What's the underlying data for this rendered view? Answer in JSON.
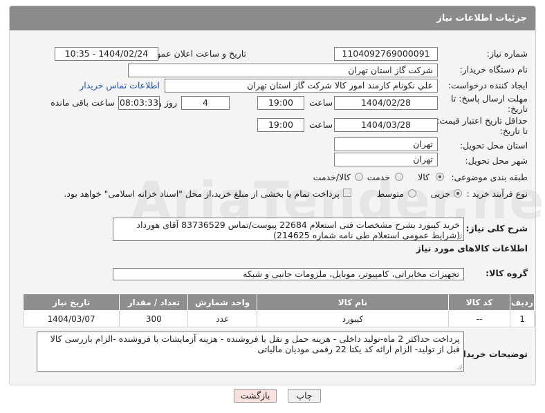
{
  "header": {
    "title": "جزئیات اطلاعات نیاز"
  },
  "form": {
    "need_number": {
      "label": "شماره نیاز:",
      "value": "1104092769000091"
    },
    "announce": {
      "label": "تاریخ و ساعت اعلان عمومی:",
      "value": "1404/02/24 - 10:35"
    },
    "buyer_org": {
      "label": "نام دستگاه خریدار:",
      "value": "شرکت گاز استان تهران"
    },
    "requester": {
      "label": "ایجاد کننده درخواست:",
      "value": "علي نکونام کارمند امور کالا شرکت گاز استان تهران",
      "contact_link": "اطلاعات تماس خریدار"
    },
    "deadline": {
      "label_line1": "مهلت ارسال پاسخ: تا",
      "label_line2": "تاریخ:",
      "date": "1404/02/28",
      "time_label": "ساعت",
      "time": "19:00",
      "days": "4",
      "days_label": "روز و",
      "remaining": "08:03:33",
      "remaining_label": "ساعت باقی مانده"
    },
    "validity": {
      "label_line1": "حداقل تاریخ اعتبار قیمت:",
      "label_line2": "تا تاریخ:",
      "date": "1404/03/28",
      "time_label": "ساعت",
      "time": "19:00"
    },
    "delivery_province": {
      "label": "استان محل تحویل:",
      "value": "تهران"
    },
    "delivery_city": {
      "label": "شهر محل تحویل:",
      "value": "تهران"
    },
    "category": {
      "label": "طبقه بندی موضوعی:",
      "options": [
        "کالا",
        "خدمت",
        "کالا/خدمت"
      ],
      "selected": "کالا"
    },
    "process": {
      "label": "نوع فرآیند خرید :",
      "options": [
        "جزیی",
        "متوسط"
      ],
      "selected": "جزیی",
      "payment_note": "پرداخت تمام یا بخشی از مبلغ خرید،از محل \"اسناد خزانه اسلامی\" خواهد بود."
    }
  },
  "summary": {
    "label": "شرح کلی نیاز:",
    "text": "خرید کیبورد بشرح مشخصات فنی استعلام 22684 پیوست/تماس 83736529 آقای هورداد (شرایط عمومی استعلام طی نامه شماره 214625)"
  },
  "goods_section": {
    "title": "اطلاعات کالاهای مورد نیاز"
  },
  "goods_group": {
    "label": "گروه کالا:",
    "value": "تجهیزات مخابراتی، کامپیوتر، موبایل، ملزومات جانبی و شبکه"
  },
  "items_table": {
    "headers": [
      "ردیف",
      "کد کالا",
      "نام کالا",
      "واحد شمارش",
      "تعداد / مقدار",
      "تاریخ نیاز"
    ],
    "rows": [
      [
        "1",
        "--",
        "کیبورد",
        "عدد",
        "300",
        "1404/03/07"
      ]
    ]
  },
  "buyer_notes": {
    "label": "توضیحات خریدار:",
    "text": "پرداخت حداکثر 2 ماه-تولید داخلی - هزینه حمل و نقل با فروشنده - هزینه آزمایشات با فروشنده -الزام بازرسی کالا قبل از تولید- الزام ارائه کد یکتا 22 رقمی مودیان مالیاتی"
  },
  "buttons": {
    "print": "چاپ",
    "back": "بازگشت"
  },
  "watermark": "AriaTender.neT",
  "colors": {
    "header_bg": "#8b8b8b",
    "link": "#1a54b5",
    "back_button_bg": "#fbe0e0"
  }
}
